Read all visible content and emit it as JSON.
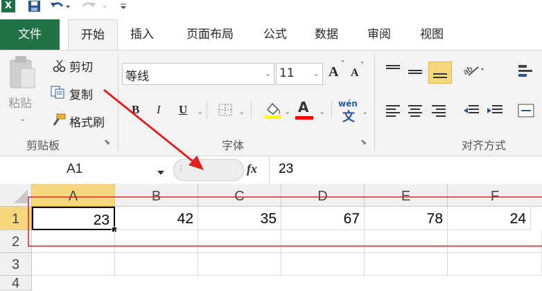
{
  "quick_access": {
    "icons": [
      "excel-logo-icon",
      "save-icon",
      "undo-icon",
      "redo-icon",
      "customize-qat-icon"
    ]
  },
  "tabs": [
    "文件",
    "开始",
    "插入",
    "页面布局",
    "公式",
    "数据",
    "审阅",
    "视图"
  ],
  "clipboard": {
    "paste": "粘贴",
    "cut": "剪切",
    "copy": "复制",
    "format_painter": "格式刷",
    "group": "剪贴板"
  },
  "font": {
    "name": "等线",
    "size": "11",
    "group": "字体",
    "bold": "B",
    "italic": "I",
    "underline": "U",
    "grow": "A",
    "shrink": "A",
    "font_color": "A",
    "phonetic": "wén"
  },
  "alignment": {
    "group": "对齐方式"
  },
  "formula_bar": {
    "name_box": "A1",
    "fx": "fx",
    "value": "23"
  },
  "sheet": {
    "columns": [
      "A",
      "B",
      "C",
      "D",
      "E",
      "F"
    ],
    "rows": [
      "1",
      "2",
      "3",
      "4"
    ],
    "data": [
      [
        "23",
        "42",
        "35",
        "67",
        "78",
        "24"
      ]
    ],
    "active_cell": "A1"
  },
  "annotation": {
    "color": "#e02020"
  },
  "colors": {
    "file_tab": "#217346",
    "ribbon_bg": "#f3f3f3",
    "selected_header": "#f6d77e",
    "active_border": "#000000"
  }
}
